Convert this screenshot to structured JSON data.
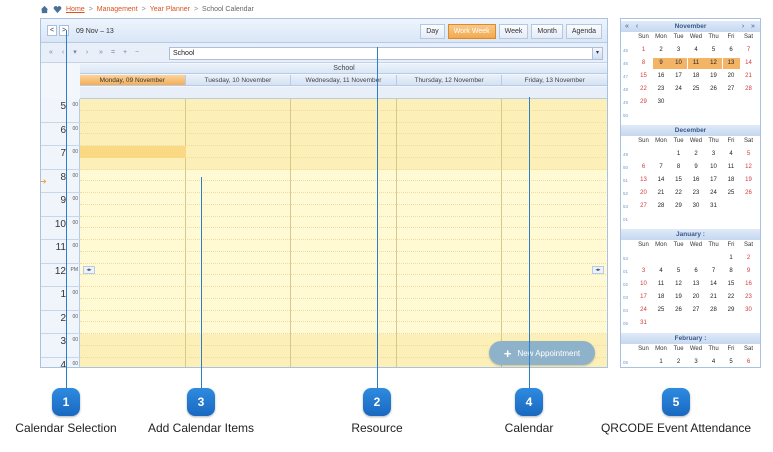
{
  "breadcrumb": {
    "home": "Home",
    "items": [
      "Management",
      "Year Planner",
      "School Calendar"
    ]
  },
  "toolbar": {
    "prev": "<",
    "next": ">",
    "date_range": "09 Nov – 13",
    "views": [
      {
        "label": "Day",
        "active": false
      },
      {
        "label": "Work Week",
        "active": true
      },
      {
        "label": "Week",
        "active": false
      },
      {
        "label": "Month",
        "active": false
      },
      {
        "label": "Agenda",
        "active": false
      }
    ]
  },
  "toolbar2": {
    "buttons": [
      "«",
      "‹",
      "▾",
      "›",
      "»",
      "=",
      "+",
      "−"
    ],
    "resource_value": "School"
  },
  "calendar": {
    "resource_header": "School",
    "days": [
      {
        "label": "Monday, 09 November",
        "selected": true
      },
      {
        "label": "Tuesday, 10 November",
        "selected": false
      },
      {
        "label": "Wednesday, 11 November",
        "selected": false
      },
      {
        "label": "Thursday, 12 November",
        "selected": false
      },
      {
        "label": "Friday, 13 November",
        "selected": false
      }
    ],
    "hours": [
      {
        "h": "5",
        "m": "00"
      },
      {
        "h": "6",
        "m": "00"
      },
      {
        "h": "7",
        "m": "00"
      },
      {
        "h": "8",
        "m": "00"
      },
      {
        "h": "9",
        "m": "00"
      },
      {
        "h": "10",
        "m": "00"
      },
      {
        "h": "11",
        "m": "00"
      },
      {
        "h": "12",
        "m": "PM"
      },
      {
        "h": "1",
        "m": "00"
      },
      {
        "h": "2",
        "m": "00"
      },
      {
        "h": "3",
        "m": "00"
      },
      {
        "h": "4",
        "m": "00"
      }
    ],
    "new_appointment": "New Appointment"
  },
  "mini_calendars": {
    "weekdays": [
      "Sun",
      "Mon",
      "Tue",
      "Wed",
      "Thu",
      "Fri",
      "Sat"
    ],
    "months": [
      {
        "name": "November",
        "weeks": [
          "45",
          "46",
          "47",
          "48",
          "49",
          "50"
        ],
        "rows": [
          [
            "1",
            "2",
            "3",
            "4",
            "5",
            "6",
            "7"
          ],
          [
            "8",
            "9",
            "10",
            "11",
            "12",
            "13",
            "14"
          ],
          [
            "15",
            "16",
            "17",
            "18",
            "19",
            "20",
            "21"
          ],
          [
            "22",
            "23",
            "24",
            "25",
            "26",
            "27",
            "28"
          ],
          [
            "29",
            "30",
            "",
            "",
            "",
            "",
            ""
          ],
          [
            "",
            "",
            "",
            "",
            "",
            "",
            ""
          ]
        ],
        "highlight": [
          "9",
          "10",
          "11",
          "12",
          "13"
        ]
      },
      {
        "name": "December",
        "weeks": [
          "49",
          "50",
          "51",
          "52",
          "53",
          "01"
        ],
        "rows": [
          [
            "",
            "",
            "1",
            "2",
            "3",
            "4",
            "5"
          ],
          [
            "6",
            "7",
            "8",
            "9",
            "10",
            "11",
            "12"
          ],
          [
            "13",
            "14",
            "15",
            "16",
            "17",
            "18",
            "19"
          ],
          [
            "20",
            "21",
            "22",
            "23",
            "24",
            "25",
            "26"
          ],
          [
            "27",
            "28",
            "29",
            "30",
            "31",
            "",
            ""
          ],
          [
            "",
            "",
            "",
            "",
            "",
            "",
            ""
          ]
        ],
        "highlight": []
      },
      {
        "name": "January :",
        "weeks": [
          "53",
          "01",
          "02",
          "03",
          "04",
          "05"
        ],
        "rows": [
          [
            "",
            "",
            "",
            "",
            "",
            "1",
            "2"
          ],
          [
            "3",
            "4",
            "5",
            "6",
            "7",
            "8",
            "9"
          ],
          [
            "10",
            "11",
            "12",
            "13",
            "14",
            "15",
            "16"
          ],
          [
            "17",
            "18",
            "19",
            "20",
            "21",
            "22",
            "23"
          ],
          [
            "24",
            "25",
            "26",
            "27",
            "28",
            "29",
            "30"
          ],
          [
            "31",
            "",
            "",
            "",
            "",
            "",
            ""
          ]
        ],
        "highlight": []
      },
      {
        "name": "February :",
        "weeks": [
          "05"
        ],
        "rows": [
          [
            "",
            "1",
            "2",
            "3",
            "4",
            "5",
            "6"
          ]
        ],
        "highlight": []
      }
    ]
  },
  "callouts": [
    {
      "num": "1",
      "label": "Calendar Selection"
    },
    {
      "num": "3",
      "label": "Add Calendar Items"
    },
    {
      "num": "2",
      "label": "Resource"
    },
    {
      "num": "4",
      "label": "Calendar"
    },
    {
      "num": "5",
      "label": "QRCODE Event Attendance"
    }
  ]
}
